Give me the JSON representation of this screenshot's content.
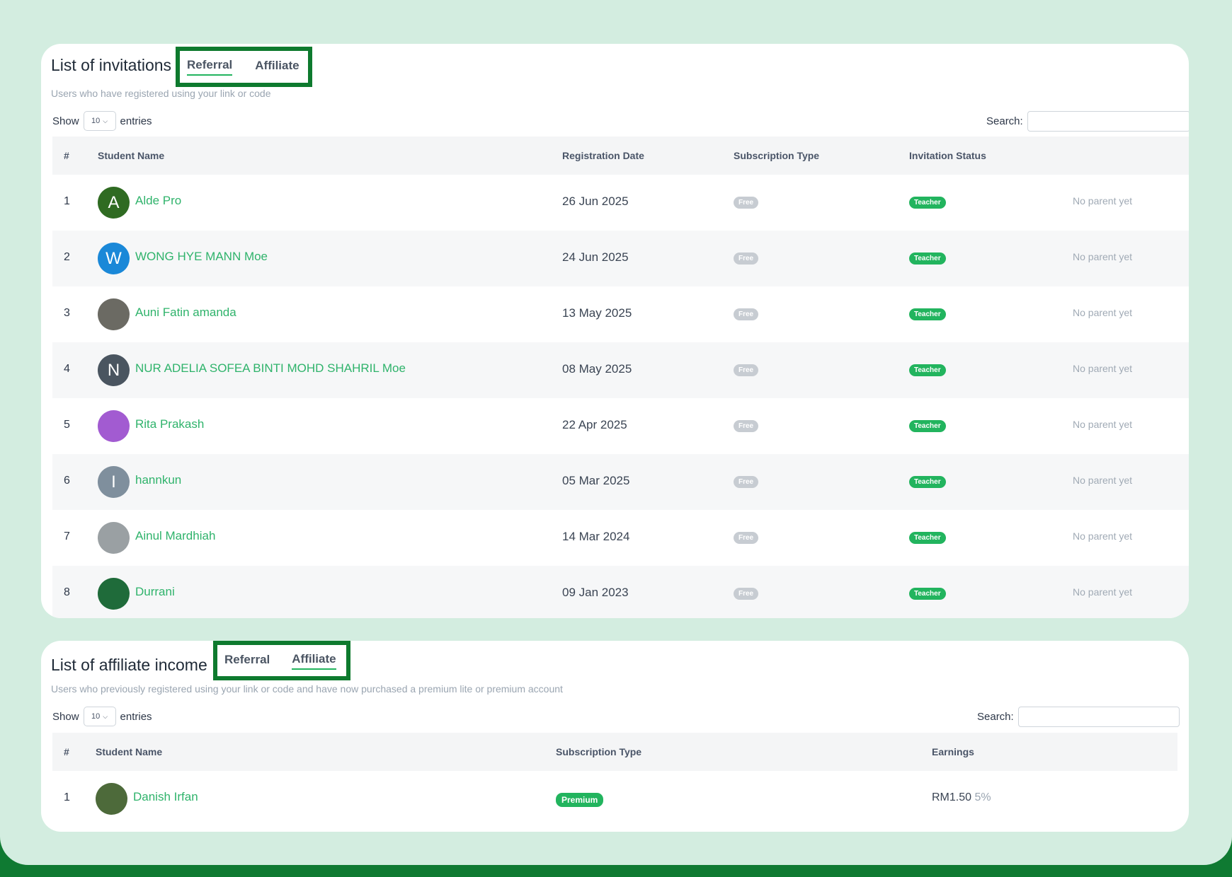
{
  "invitations": {
    "title": "List of invitations",
    "tabs": [
      "Referral",
      "Affiliate"
    ],
    "active_tab": "Referral",
    "subtitle": "Users who have registered using your link or code",
    "show_label": "Show",
    "entries_value": "10",
    "entries_label": "entries",
    "search_label": "Search:",
    "columns": [
      "#",
      "Student Name",
      "Registration Date",
      "Subscription Type",
      "Invitation Status"
    ],
    "rows": [
      {
        "num": "1",
        "initial": "A",
        "avatar_color": "#2f6b22",
        "name": "Alde Pro",
        "date": "26 Jun 2025",
        "subscription": "Free",
        "status": "Teacher",
        "parent": "No parent yet"
      },
      {
        "num": "2",
        "initial": "W",
        "avatar_color": "#1a88d8",
        "name": "WONG HYE MANN Moe",
        "date": "24 Jun 2025",
        "subscription": "Free",
        "status": "Teacher",
        "parent": "No parent yet"
      },
      {
        "num": "3",
        "initial": "",
        "avatar_color": "#6b6a63",
        "name": "Auni Fatin amanda",
        "date": "13 May 2025",
        "subscription": "Free",
        "status": "Teacher",
        "parent": "No parent yet"
      },
      {
        "num": "4",
        "initial": "N",
        "avatar_color": "#4a5560",
        "name": "NUR ADELIA SOFEA BINTI MOHD SHAHRIL Moe",
        "date": "08 May 2025",
        "subscription": "Free",
        "status": "Teacher",
        "parent": "No parent yet"
      },
      {
        "num": "5",
        "initial": "",
        "avatar_color": "#a25bd1",
        "name": "Rita Prakash",
        "date": "22 Apr 2025",
        "subscription": "Free",
        "status": "Teacher",
        "parent": "No parent yet"
      },
      {
        "num": "6",
        "initial": "I",
        "avatar_color": "#7f8f9d",
        "name": "hannkun",
        "date": "05 Mar 2025",
        "subscription": "Free",
        "status": "Teacher",
        "parent": "No parent yet"
      },
      {
        "num": "7",
        "initial": "",
        "avatar_color": "#9aa0a3",
        "name": "Ainul Mardhiah",
        "date": "14 Mar 2024",
        "subscription": "Free",
        "status": "Teacher",
        "parent": "No parent yet"
      },
      {
        "num": "8",
        "initial": "",
        "avatar_color": "#1f6b3a",
        "name": "Durrani",
        "date": "09 Jan 2023",
        "subscription": "Free",
        "status": "Teacher",
        "parent": "No parent yet"
      }
    ]
  },
  "affiliate": {
    "title": "List of affiliate income",
    "tabs": [
      "Referral",
      "Affiliate"
    ],
    "active_tab": "Affiliate",
    "subtitle": "Users who previously registered using your link or code and have now purchased a premium lite or premium account",
    "show_label": "Show",
    "entries_value": "10",
    "entries_label": "entries",
    "search_label": "Search:",
    "columns": [
      "#",
      "Student Name",
      "Subscription Type",
      "Earnings"
    ],
    "rows": [
      {
        "num": "1",
        "initial": "",
        "avatar_color": "#4d6a3a",
        "name": "Danish Irfan",
        "subscription": "Premium",
        "earnings": "RM1.50",
        "percent": "5%"
      }
    ]
  },
  "colors": {
    "accent_green": "#22b45e",
    "highlight_border": "#0e7a2e",
    "background_mint": "#d3ede0"
  }
}
